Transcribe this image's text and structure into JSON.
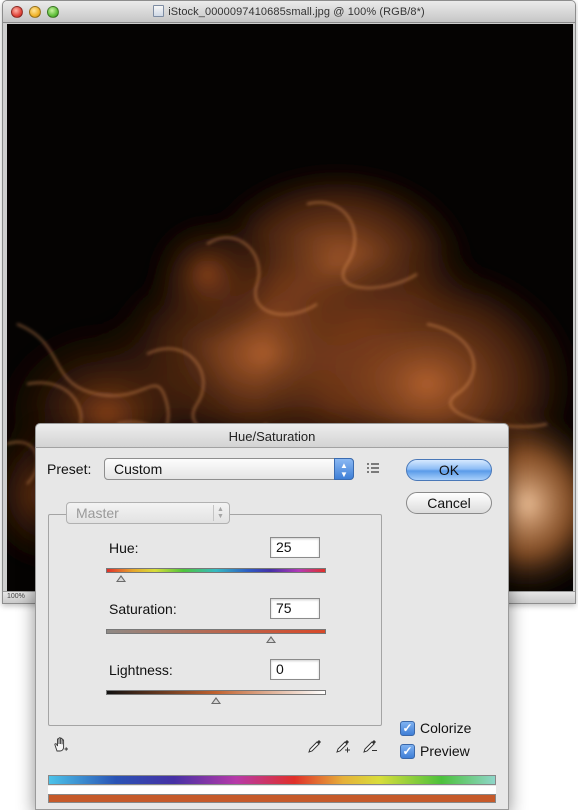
{
  "document_window": {
    "title": "iStock_0000097410685small.jpg @ 100% (RGB/8*)",
    "zoom": "100%"
  },
  "dialog": {
    "title": "Hue/Saturation",
    "preset_label": "Preset:",
    "preset_value": "Custom",
    "ok_label": "OK",
    "cancel_label": "Cancel",
    "channel_value": "Master",
    "hue": {
      "label": "Hue:",
      "value": "25",
      "range": [
        -180,
        180
      ]
    },
    "saturation": {
      "label": "Saturation:",
      "value": "75",
      "range": [
        0,
        100
      ]
    },
    "lightness": {
      "label": "Lightness:",
      "value": "0",
      "range": [
        -100,
        100
      ]
    },
    "colorize": {
      "label": "Colorize",
      "checked": true
    },
    "preview": {
      "label": "Preview",
      "checked": true
    }
  },
  "icons": [
    "traffic-light-close",
    "traffic-light-minimize",
    "traffic-light-zoom",
    "file-icon",
    "preset-options-icon",
    "hand-tool-icon",
    "eyedropper-icon",
    "eyedropper-plus-icon",
    "eyedropper-minus-icon"
  ],
  "colors": {
    "smoke_tint": "#c96a2c",
    "ok_accent": "#5a9be9",
    "colorize_result": "#c65a2a"
  }
}
